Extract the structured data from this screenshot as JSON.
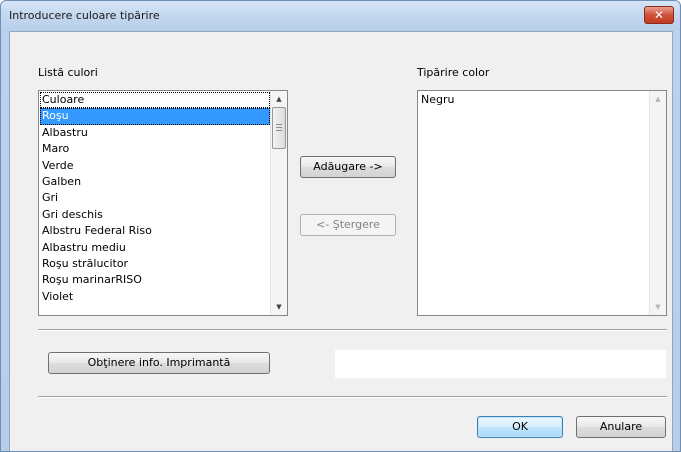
{
  "window": {
    "title": "Introducere culoare tipărire",
    "close_glyph": "✕"
  },
  "color_list": {
    "label": "Listă culori",
    "items": [
      "Culoare",
      "Roşu",
      "Albastru",
      "Maro",
      "Verde",
      "Galben",
      "Gri",
      "Gri deschis",
      "Albstru Federal Riso",
      "Albastru mediu",
      "Roşu strălucitor",
      "Roşu marinarRISO",
      "Violet"
    ],
    "selected_index": 1,
    "focused_index": 0
  },
  "print_color": {
    "label": "Tipărire color",
    "items": [
      "Negru"
    ]
  },
  "buttons": {
    "add": "Adăugare ->",
    "remove": "<- Ştergere",
    "get_info": "Obţinere info. Imprimantă",
    "ok": "OK",
    "cancel": "Anulare"
  },
  "scroll": {
    "up_glyph": "▲",
    "down_glyph": "▼"
  },
  "info_text": ""
}
